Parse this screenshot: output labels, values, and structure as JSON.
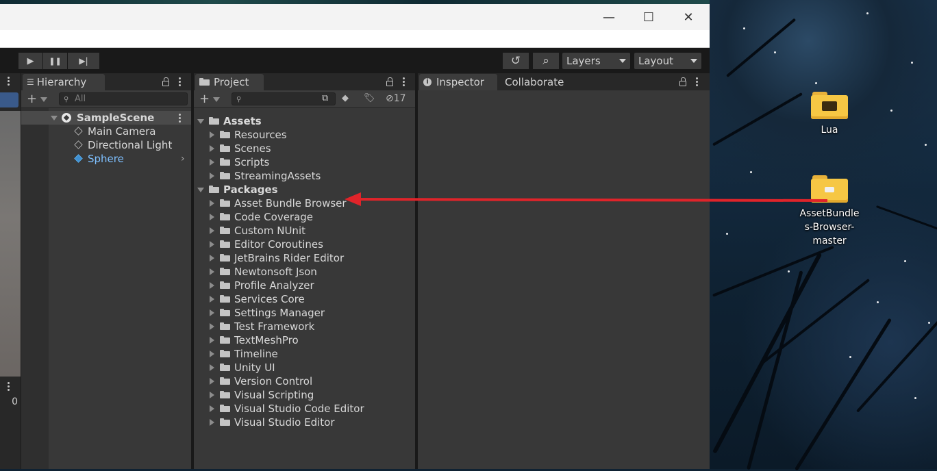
{
  "window": {
    "controls": {
      "minimize": "—",
      "maximize": "☐",
      "close": "✕"
    }
  },
  "toolbar": {
    "play_glyph": "▶",
    "pause_glyph": "❚❚",
    "step_glyph": "▶|",
    "history_glyph": "↺",
    "search_glyph": "⌕",
    "layers_label": "Layers",
    "layout_label": "Layout"
  },
  "scene_view": {
    "counter": "0"
  },
  "hierarchy": {
    "tab_label": "Hierarchy",
    "search_placeholder": "All",
    "scene_name": "SampleScene",
    "objects": [
      "Main Camera",
      "Directional Light",
      "Sphere"
    ]
  },
  "project": {
    "tab_label": "Project",
    "hidden_count": "17",
    "assets_label": "Assets",
    "asset_folders": [
      "Resources",
      "Scenes",
      "Scripts",
      "StreamingAssets"
    ],
    "packages_label": "Packages",
    "package_folders": [
      "Asset Bundle Browser",
      "Code Coverage",
      "Custom NUnit",
      "Editor Coroutines",
      "JetBrains Rider Editor",
      "Newtonsoft Json",
      "Profile Analyzer",
      "Services Core",
      "Settings Manager",
      "Test Framework",
      "TextMeshPro",
      "Timeline",
      "Unity UI",
      "Version Control",
      "Visual Scripting",
      "Visual Studio Code Editor",
      "Visual Studio Editor"
    ]
  },
  "inspector": {
    "tab_label": "Inspector",
    "collab_label": "Collaborate"
  },
  "desktop": {
    "icons": [
      {
        "label": "Lua"
      },
      {
        "label_lines": [
          "AssetBundle",
          "s-Browser-",
          "master"
        ]
      }
    ]
  },
  "colors": {
    "annotation_arrow": "#e0242a",
    "selected_text": "#7ec0ff",
    "folder_yellow": "#f6c744"
  }
}
